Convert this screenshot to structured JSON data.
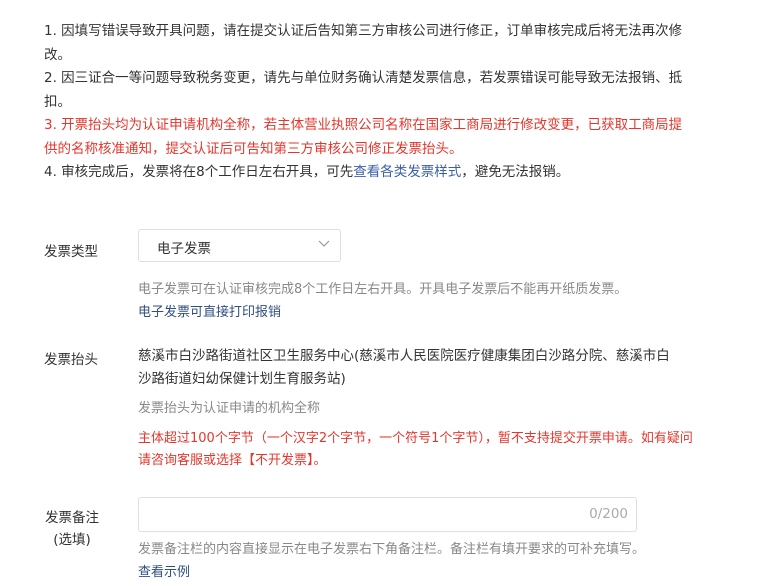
{
  "notes": {
    "n1": "1. 因填写错误导致开具问题，请在提交认证后告知第三方审核公司进行修正，订单审核完成后将无法再次修改。",
    "n2": "2. 因三证合一等问题导致税务变更，请先与单位财务确认清楚发票信息，若发票错误可能导致无法报销、抵扣。",
    "n3": "3. 开票抬头均为认证申请机构全称，若主体营业执照公司名称在国家工商局进行修改变更，已获取工商局提供的名称核准通知，提交认证后可告知第三方审核公司修正发票抬头。",
    "n4_prefix": "4. 审核完成后，发票将在8个工作日左右开具，可先",
    "n4_link": "查看各类发票样式",
    "n4_suffix": "，避免无法报销。"
  },
  "invoice_type": {
    "label": "发票类型",
    "selected": "电子发票",
    "hint": "电子发票可在认证审核完成8个工作日左右开具。开具电子发票后不能再开纸质发票。",
    "hint2": "电子发票可直接打印报销"
  },
  "invoice_title": {
    "label": "发票抬头",
    "value": "慈溪市白沙路街道社区卫生服务中心(慈溪市人民医院医疗健康集团白沙路分院、慈溪市白沙路街道妇幼保健计划生育服务站)",
    "hint": "发票抬头为认证申请的机构全称",
    "warning": "主体超过100个字节（一个汉字2个字节，一个符号1个字节），暂不支持提交开票申请。如有疑问请咨询客服或选择【不开发票】。"
  },
  "invoice_remark": {
    "label_line1": "发票备注",
    "label_line2": "(选填)",
    "counter": "0/200",
    "hint": "发票备注栏的内容直接显示在电子发票右下角备注栏。备注栏有填开要求的可补充填写。",
    "example_link": "查看示例"
  }
}
